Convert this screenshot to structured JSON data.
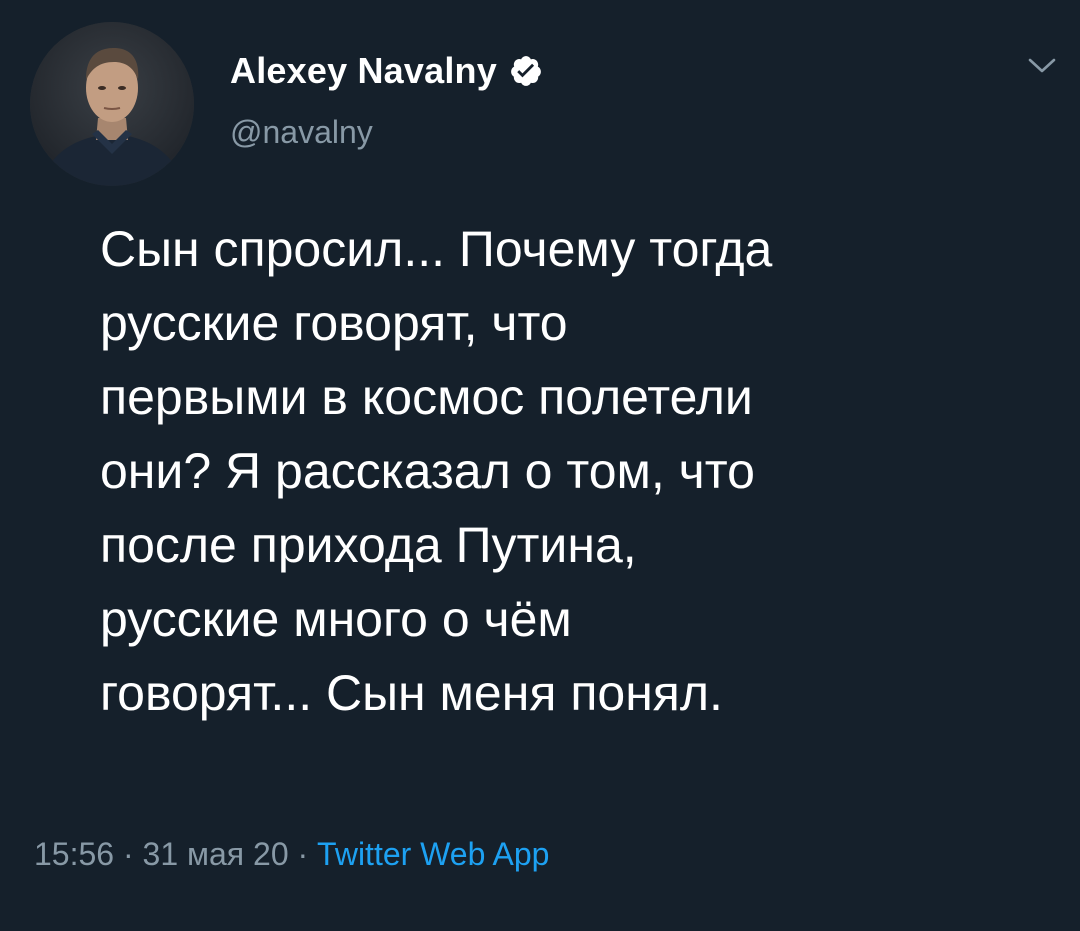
{
  "tweet": {
    "author": {
      "name": "Alexey Navalny",
      "handle": "@navalny",
      "verified": true
    },
    "text": "Сын спросил... Почему тогда\nрусские говорят, что\nпервыми в космос полетели\nони? Я рассказал о том, что\nпосле прихода Путина,\nрусские много о чём\nговорят... Сын меня понял.",
    "time": "15:56",
    "separator": " · ",
    "date": "31 мая 20",
    "source": "Twitter Web App"
  },
  "icons": {
    "verified": "verified-badge-icon",
    "menu": "chevron-down-icon"
  },
  "colors": {
    "background": "#15202b",
    "text": "#ffffff",
    "secondary": "#8899a6",
    "accent": "#1da1f2"
  }
}
